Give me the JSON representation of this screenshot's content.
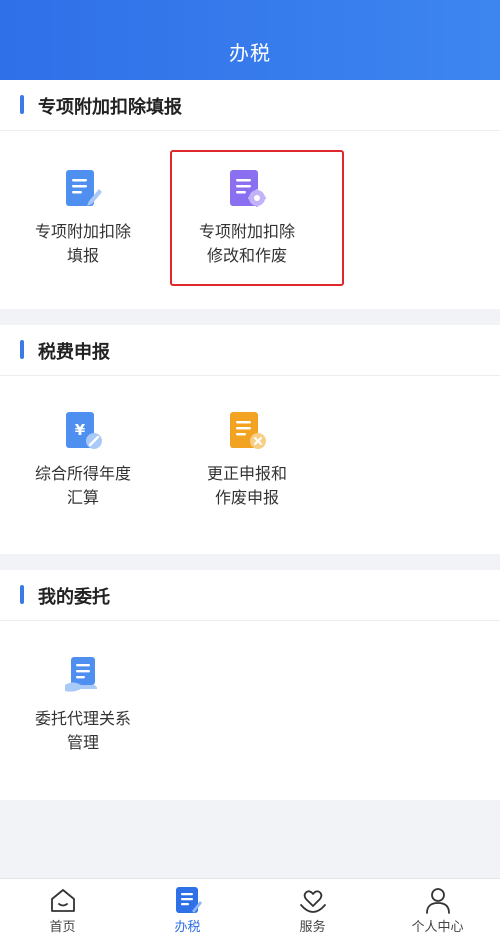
{
  "header": {
    "title": "办税"
  },
  "sections": [
    {
      "title": "专项附加扣除填报",
      "tiles": [
        {
          "line1": "专项附加扣除",
          "line2": "填报",
          "icon": "edit-document-icon"
        },
        {
          "line1": "专项附加扣除",
          "line2": "修改和作废",
          "icon": "settings-document-icon"
        }
      ]
    },
    {
      "title": "税费申报",
      "tiles": [
        {
          "line1": "综合所得年度",
          "line2": "汇算",
          "icon": "yuan-document-icon"
        },
        {
          "line1": "更正申报和",
          "line2": "作废申报",
          "icon": "cancel-document-icon"
        }
      ]
    },
    {
      "title": "我的委托",
      "tiles": [
        {
          "line1": "委托代理关系",
          "line2": "管理",
          "icon": "hand-document-icon"
        }
      ]
    }
  ],
  "tabbar": {
    "items": [
      {
        "label": "首页",
        "icon": "home-icon"
      },
      {
        "label": "办税",
        "icon": "tax-document-icon",
        "active": true
      },
      {
        "label": "服务",
        "icon": "heart-hands-icon"
      },
      {
        "label": "个人中心",
        "icon": "person-icon"
      }
    ]
  },
  "colors": {
    "brand": "#2f6fe8",
    "highlight": "#e0272b",
    "blue_icon": "#4e8ff0",
    "purple_icon": "#8a6ff0",
    "orange_icon": "#f2a321"
  }
}
